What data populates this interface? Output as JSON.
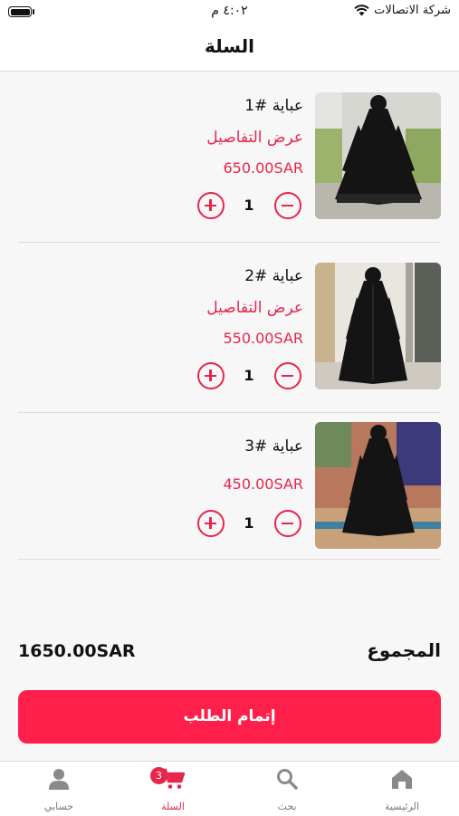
{
  "status_bar": {
    "carrier": "شركة الاتصالات",
    "time": "٤:٠٢ م"
  },
  "header": {
    "title": "السلة"
  },
  "cart": {
    "items": [
      {
        "name": "عباية #1",
        "details_link": "عرض التفاصيل",
        "price": "650.00SAR",
        "quantity": "1"
      },
      {
        "name": "عباية #2",
        "details_link": "عرض التفاصيل",
        "price": "550.00SAR",
        "quantity": "1"
      },
      {
        "name": "عباية #3",
        "price": "450.00SAR",
        "quantity": "1"
      }
    ]
  },
  "summary": {
    "total_label": "المجموع",
    "total_value": "1650.00SAR"
  },
  "checkout": {
    "label": "إتمام الطلب"
  },
  "tab_bar": {
    "tabs": [
      {
        "label": "الرئيسية",
        "icon": "home-icon"
      },
      {
        "label": "بحث",
        "icon": "search-icon"
      },
      {
        "label": "السلة",
        "icon": "cart-icon",
        "badge": "3",
        "active": true
      },
      {
        "label": "حسابي",
        "icon": "person-icon"
      }
    ]
  },
  "colors": {
    "accent": "#e8254a",
    "checkout_button": "#ff1f4b",
    "background": "#f7f7f7"
  }
}
